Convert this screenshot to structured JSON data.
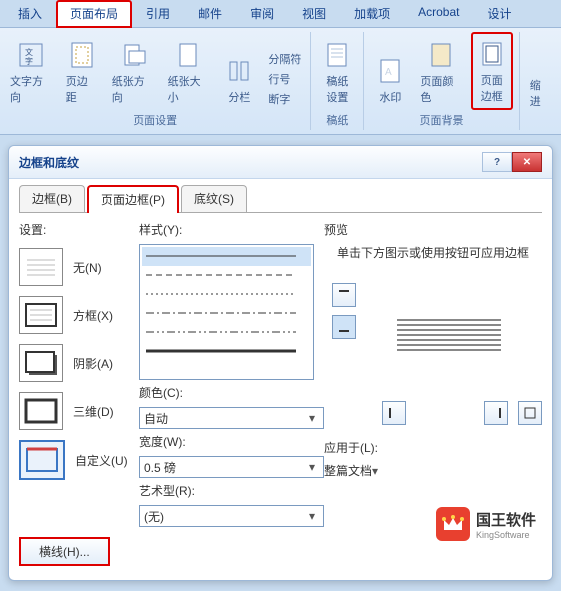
{
  "ribbon": {
    "tabs": [
      "插入",
      "页面布局",
      "引用",
      "邮件",
      "审阅",
      "视图",
      "加载项",
      "Acrobat",
      "设计"
    ],
    "active_tab": 1,
    "groups": {
      "page_setup": {
        "text_direction": "文字方向",
        "margins": "页边距",
        "orientation": "纸张方向",
        "size": "纸张大小",
        "columns": "分栏",
        "breaks": "分隔符",
        "line_numbers": "行号",
        "hyphenation": "断字",
        "label": "页面设置"
      },
      "manuscript": {
        "settings": "稿纸\n设置",
        "label": "稿纸"
      },
      "background": {
        "watermark": "水印",
        "page_color": "页面颜色",
        "page_border": "页面\n边框",
        "label": "页面背景"
      },
      "indent": {
        "label": "缩进"
      }
    }
  },
  "dialog": {
    "title": "边框和底纹",
    "tabs": {
      "borders": "边框(B)",
      "page_borders": "页面边框(P)",
      "shading": "底纹(S)"
    },
    "settings": {
      "label": "设置:",
      "none": "无(N)",
      "box": "方框(X)",
      "shadow": "阴影(A)",
      "three_d": "三维(D)",
      "custom": "自定义(U)"
    },
    "style": {
      "label": "样式(Y):",
      "color_label": "颜色(C):",
      "color_value": "自动",
      "width_label": "宽度(W):",
      "width_value": "0.5 磅",
      "art_label": "艺术型(R):",
      "art_value": "(无)"
    },
    "preview": {
      "label": "预览",
      "hint": "单击下方图示或使用按钮可应用边框",
      "apply_label": "应用于(L):",
      "apply_value": "整篇文档"
    },
    "hline_button": "横线(H)..."
  },
  "watermark": {
    "text": "国王软件",
    "sub": "KingSoftware"
  }
}
